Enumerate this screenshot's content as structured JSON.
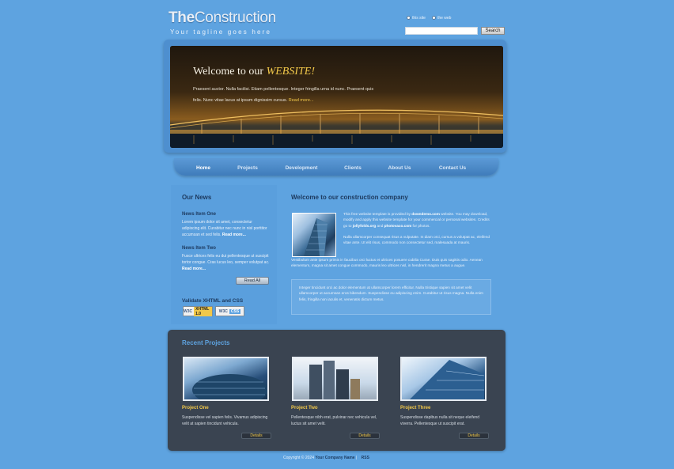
{
  "header": {
    "logo_bold": "The",
    "logo_thin": "Construction",
    "tagline": "Your tagline goes here",
    "search": {
      "radio_1": "this site",
      "radio_2": "the web",
      "placeholder": "",
      "button": "Search"
    }
  },
  "banner": {
    "title_start": "Welcome to our ",
    "title_em": "WEBSITE!",
    "text": "Praesent auctor. Nulla facilisi. Etiam pellentesque. Integer fringilla urna id nunc. Praesent quis felis. Nunc vitae lacus at ipsum dignissim cursus.",
    "read_more": "Read more..."
  },
  "nav": {
    "items": [
      "Home",
      "Projects",
      "Development",
      "Clients",
      "About Us",
      "Contact Us"
    ]
  },
  "sidebar": {
    "title": "Our News",
    "news": [
      {
        "title": "News Item One",
        "text": "Lorem ipsum dolor sit amet, consectetur adipiscing elit. Curabitur nec nunc in nisl porttitor accumsan et sed felis.",
        "read_more": "Read more..."
      },
      {
        "title": "News Item Two",
        "text": "Fusce ultrices felis eu dui pellentesque ut suscipit tortor congue. Cras lucus leo, semper volutpat ac.",
        "read_more": "Read more..."
      }
    ],
    "read_all": "Read All",
    "validate_title": "Validate XHTML and CSS",
    "badge_xhtml_w3c": "W3C",
    "badge_xhtml": "XHTML 1.0",
    "badge_css_w3c": "W3C",
    "badge_css": "CSS"
  },
  "main": {
    "title": "Welcome to our construction company",
    "p1_start": "This free website template is provided by ",
    "p1_link1": "downdemo.com",
    "p1_mid": " website. You may download, modify and apply this website template for your commercial or personal websites. Credits go to ",
    "p1_link2": "jollyfolds.org",
    "p1_and": " and ",
    "p1_link3": "photovaco.com",
    "p1_end": " for photos.",
    "p2": "Nulla ullamcorper consequat risus a vulputate. In diam orci, cursus a volutpat ac, eleifend vitae ante. Ut elit risus, commodo non consectetur sed, malesuada at mauris.",
    "p3": "Vestibulum ante ipsum primis in faucibus orci luctus et ultrices posuere cubilia Curae. Duis quis sagittis odio. Aenean elementum, magna sit amet congue commodo, mauris leo ultrices nisl, in hendrerit magna metus a augue.",
    "quote": "Integer tincidunt orci ac dolor elementum at ullamcorper lorem efficitur. Nulla tristique sapien sit amet velit ullamcorper ut accumsan eros bibendum. Suspendisse eu adipiscing enim. Curabitur ut risus magna. Nulla enim felis, fringilla non iaculis et, venenatis dictum metus."
  },
  "projects": {
    "title": "Recent Projects",
    "items": [
      {
        "name": "Project One",
        "desc": "Suspendisse vel sapien felis. Vivamus adipiscing velit at sapien tincidunt vehicula.",
        "button": "Details"
      },
      {
        "name": "Project Two",
        "desc": "Pellentesque nibh erat, pulvinar nec vehicula vel, luctus sit amet velit.",
        "button": "Details"
      },
      {
        "name": "Project Three",
        "desc": "Suspendisse dapibus nulla sit neque eleifend viverra. Pellentesque ut suscipit erat.",
        "button": "Details"
      }
    ]
  },
  "footer": {
    "copyright": "Copyright © 2024 ",
    "company": "Your Company Name",
    "sep": " | ",
    "rss": "RSS"
  },
  "colors": {
    "background": "#5ea3e0",
    "accent": "#f1c84a",
    "dark_panel": "#3a4451"
  }
}
